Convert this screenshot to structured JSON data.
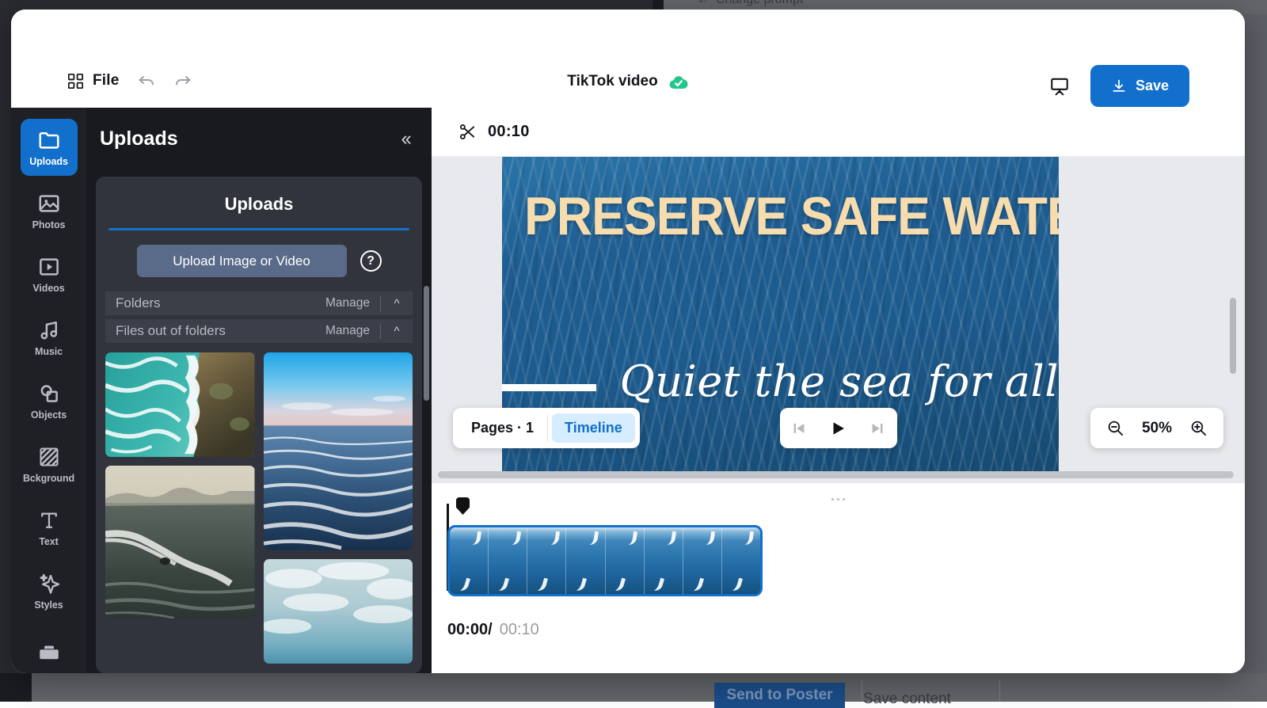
{
  "backdrop": {
    "change_prompt": "Change prompt",
    "send_to_poster": "Send to Poster",
    "save_content": "Save content"
  },
  "modal": {
    "close_icon": "close-icon"
  },
  "header": {
    "grid_icon": "grid-icon",
    "file_label": "File",
    "undo_icon": "undo-icon",
    "redo_icon": "redo-icon",
    "doc_title": "TikTok video",
    "sync_status_icon": "cloud-check-icon",
    "present_icon": "presentation-icon",
    "save_label": "Save",
    "save_icon": "download-icon",
    "accent_color": "#1270CC"
  },
  "rail": {
    "items": [
      {
        "label": "Uploads",
        "icon": "folder-icon",
        "active": true
      },
      {
        "label": "Photos",
        "icon": "image-icon",
        "active": false
      },
      {
        "label": "Videos",
        "icon": "video-icon",
        "active": false
      },
      {
        "label": "Music",
        "icon": "music-note-icon",
        "active": false
      },
      {
        "label": "Objects",
        "icon": "shapes-icon",
        "active": false
      },
      {
        "label": "Bckground",
        "icon": "hatch-pattern-icon",
        "active": false
      },
      {
        "label": "Text",
        "icon": "text-t-icon",
        "active": false
      },
      {
        "label": "Styles",
        "icon": "sparkle-icon",
        "active": false
      },
      {
        "label": "",
        "icon": "toolbox-icon",
        "active": false
      }
    ]
  },
  "panel": {
    "title": "Uploads",
    "collapse_icon": "chevron-double-left-icon",
    "card_title": "Uploads",
    "upload_button": "Upload Image or Video",
    "help_icon": "question-mark-icon",
    "accordions": [
      {
        "name": "Folders",
        "manage": "Manage",
        "chevron": "chevron-up-icon"
      },
      {
        "name": "Files out of folders",
        "manage": "Manage",
        "chevron": "chevron-up-icon"
      }
    ],
    "thumbnails": [
      {
        "name": "ocean-waves-rocky-coast",
        "column": 0
      },
      {
        "name": "surf-break-at-dusk",
        "column": 0
      },
      {
        "name": "open-sea-under-blue-sky",
        "column": 1
      },
      {
        "name": "cloudy-sky-over-sea",
        "column": 1
      }
    ],
    "scrollbar": "panel-scrollbar"
  },
  "editor": {
    "clip_icon": "scissors-icon",
    "clip_duration": "00:10",
    "canvas": {
      "headline": "PRESERVE SAFE WATERS",
      "headline_color": "#F7DDAE",
      "subline": "Quiet the sea for all",
      "subline_color": "#FFFFFF",
      "background": "ocean-water-video"
    },
    "pages_label": "Pages · 1",
    "timeline_label": "Timeline",
    "timeline_active_color": "#1270CC",
    "player": {
      "prev_icon": "skip-previous-icon",
      "play_icon": "play-icon",
      "next_icon": "skip-next-icon"
    },
    "zoom": {
      "out_icon": "zoom-out-icon",
      "value": "50%",
      "in_icon": "zoom-in-icon"
    },
    "drag_handle": "resize-handle"
  },
  "timeline": {
    "playhead": "playhead",
    "clip_name": "ocean-video-clip",
    "frame_count": 8,
    "current_time": "00:00/",
    "total_time": "00:10"
  }
}
